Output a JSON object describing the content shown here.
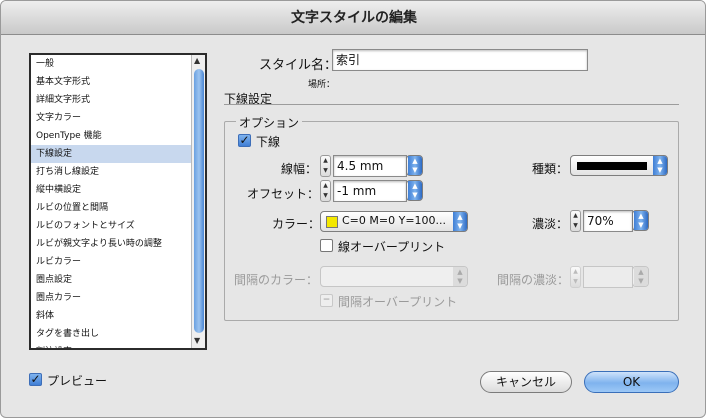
{
  "window": {
    "title": "文字スタイルの編集"
  },
  "sidebar": {
    "items": [
      {
        "label": "一般"
      },
      {
        "label": "基本文字形式"
      },
      {
        "label": "詳細文字形式"
      },
      {
        "label": "文字カラー"
      },
      {
        "label": "OpenType 機能"
      },
      {
        "label": "下線設定",
        "selected": true
      },
      {
        "label": "打ち消し線設定"
      },
      {
        "label": "縦中横設定"
      },
      {
        "label": "ルビの位置と間隔"
      },
      {
        "label": "ルビのフォントとサイズ"
      },
      {
        "label": "ルビが親文字より長い時の調整"
      },
      {
        "label": "ルビカラー"
      },
      {
        "label": "圏点設定"
      },
      {
        "label": "圏点カラー"
      },
      {
        "label": "斜体"
      },
      {
        "label": "タグを書き出し"
      },
      {
        "label": "割注設定"
      }
    ]
  },
  "header": {
    "style_name_label": "スタイル名：",
    "style_name_value": "索引",
    "location_label": "場所：",
    "section_title": "下線設定"
  },
  "options": {
    "group_title": "オプション",
    "underline_label": "下線",
    "underline_checked": true,
    "weight_label": "線幅：",
    "weight_value": "4.5 mm",
    "offset_label": "オフセット：",
    "offset_value": "-1 mm",
    "type_label": "種類：",
    "color_label": "カラー：",
    "color_value": "C=0 M=0 Y=100...",
    "color_swatch": "#f4e800",
    "tint_label": "濃淡：",
    "tint_value": "70%",
    "overprint_label": "線オーバープリント",
    "overprint_checked": false,
    "gap_color_label": "間隔のカラー：",
    "gap_tint_label": "間隔の濃淡：",
    "gap_overprint_label": "間隔オーバープリント"
  },
  "footer": {
    "preview_label": "プレビュー",
    "preview_checked": true,
    "cancel_label": "キャンセル",
    "ok_label": "OK"
  },
  "colors": {
    "accent": "#3f7ed5",
    "selection": "#c8d8ee"
  }
}
